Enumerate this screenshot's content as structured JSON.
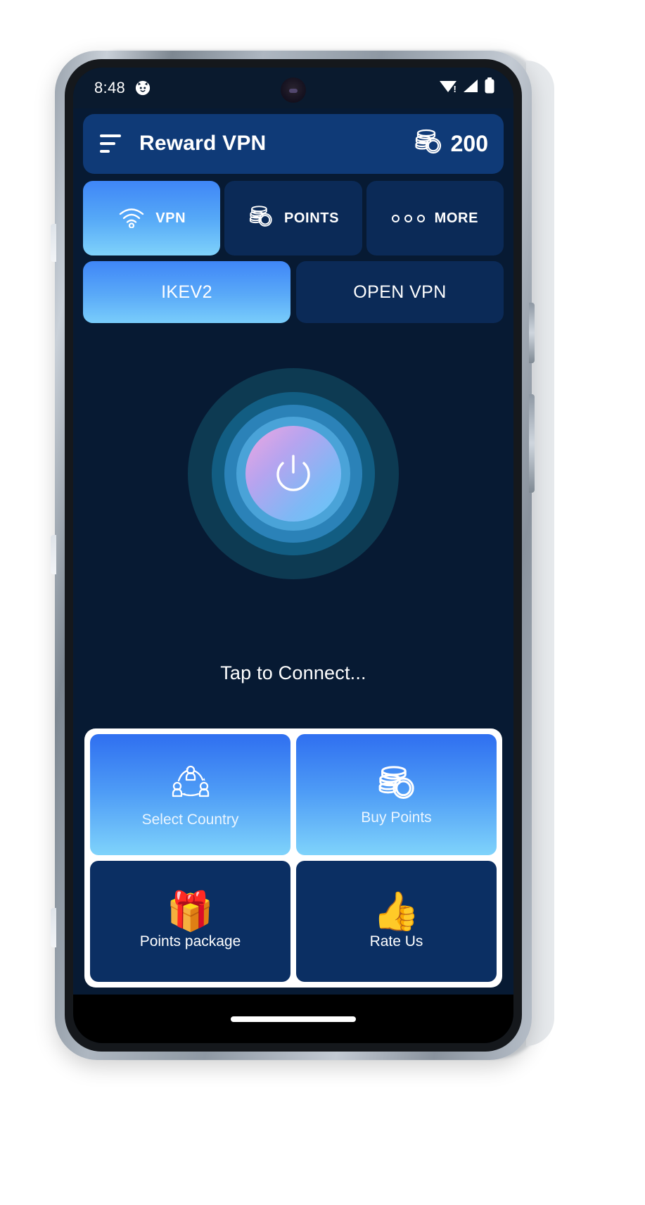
{
  "device": {
    "frame": "android-phone",
    "nav_bar": "gesture-pill"
  },
  "status_bar": {
    "time": "8:48",
    "notification_icon": "cat-face-icon",
    "wifi_icon": "wifi-warning-icon",
    "cellular_icon": "cellular-signal-icon",
    "battery_icon": "battery-full-icon"
  },
  "app_bar": {
    "menu_icon": "hamburger-menu-icon",
    "title": "Reward VPN",
    "points_icon": "coin-stack-icon",
    "points_value": "200"
  },
  "tabs": [
    {
      "label": "VPN",
      "icon": "wifi-icon",
      "active": true
    },
    {
      "label": "POINTS",
      "icon": "coin-stack-icon",
      "active": false
    },
    {
      "label": "MORE",
      "icon": "three-dots-icon",
      "active": false
    }
  ],
  "protocols": [
    {
      "label": "IKEV2",
      "active": true
    },
    {
      "label": "OPEN VPN",
      "active": false
    }
  ],
  "connect": {
    "power_icon": "power-icon",
    "status_text": "Tap to Connect..."
  },
  "action_cards": [
    {
      "label": "Select Country",
      "icon": "people-network-icon",
      "style": "blue"
    },
    {
      "label": "Buy Points",
      "icon": "coin-stack-icon",
      "style": "blue"
    },
    {
      "label": "Points package",
      "icon": "🎁",
      "style": "dark"
    },
    {
      "label": "Rate Us",
      "icon": "👍",
      "style": "dark"
    }
  ],
  "colors": {
    "screen_bg": "#071a33",
    "status_bar_bg": "#0a1a2e",
    "app_bar_bg": "#0f3a77",
    "tab_inactive_bg": "#0b2a57",
    "accent_blue": "#3f86f7",
    "accent_cyan": "#7fd2fb",
    "card_dark_bg": "#0b2f63",
    "grid_container_bg": "#ffffff",
    "text_primary": "#ffffff"
  }
}
